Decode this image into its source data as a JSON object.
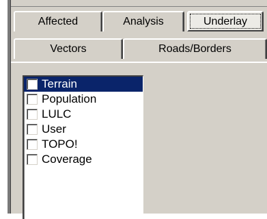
{
  "tabs": {
    "row1": [
      {
        "label": "Affected"
      },
      {
        "label": "Analysis"
      },
      {
        "label": "Underlay",
        "selected": true
      }
    ],
    "row2": [
      {
        "label": "Vectors"
      },
      {
        "label": "Roads/Borders"
      }
    ]
  },
  "underlay_list": {
    "items": [
      {
        "label": "Terrain",
        "checked": false,
        "selected": true
      },
      {
        "label": "Population",
        "checked": false
      },
      {
        "label": "LULC",
        "checked": false
      },
      {
        "label": "User",
        "checked": false
      },
      {
        "label": "TOPO!",
        "checked": false
      },
      {
        "label": "Coverage",
        "checked": false
      }
    ]
  },
  "colors": {
    "dialog_face": "#d4d0c8",
    "selection_highlight": "#0a246a"
  }
}
